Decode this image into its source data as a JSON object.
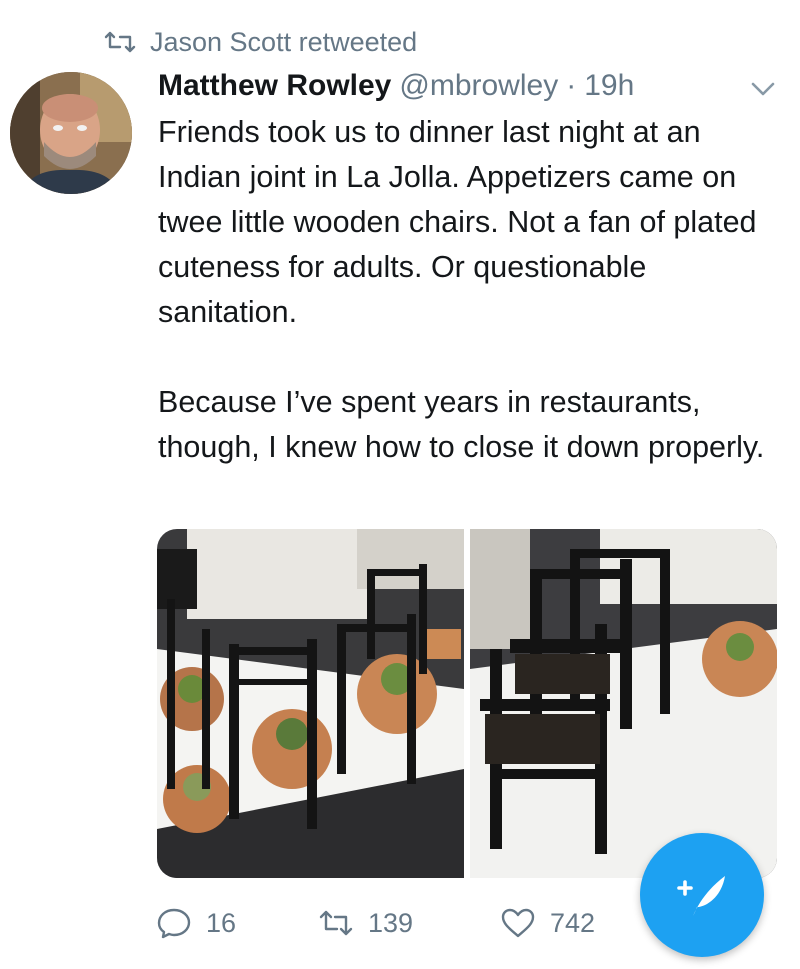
{
  "retweet_header": {
    "icon": "retweet-icon",
    "text": "Jason Scott retweeted"
  },
  "tweet": {
    "author_name": "Matthew Rowley",
    "handle": "@mbrowley",
    "separator": "·",
    "timestamp": "19h",
    "menu_icon": "chevron-down-icon",
    "paragraphs": [
      "Friends took us to dinner last night at an Indian joint in La Jolla. Appetizers came on twee little wooden chairs. Not a fan of plated cuteness for adults. Or questionable sanitation.",
      "Because I’ve spent years in restaurants, though, I knew how to close it down properly."
    ],
    "media_count": 2
  },
  "actions": {
    "reply": {
      "icon": "reply-icon",
      "count": "16"
    },
    "retweet": {
      "icon": "retweet-icon",
      "count": "139"
    },
    "like": {
      "icon": "heart-icon",
      "count": "742"
    }
  },
  "compose_button": {
    "icon": "compose-tweet-icon",
    "color": "#1da1f2"
  },
  "colors": {
    "text": "#14171a",
    "muted": "#657786",
    "accent": "#1da1f2"
  }
}
